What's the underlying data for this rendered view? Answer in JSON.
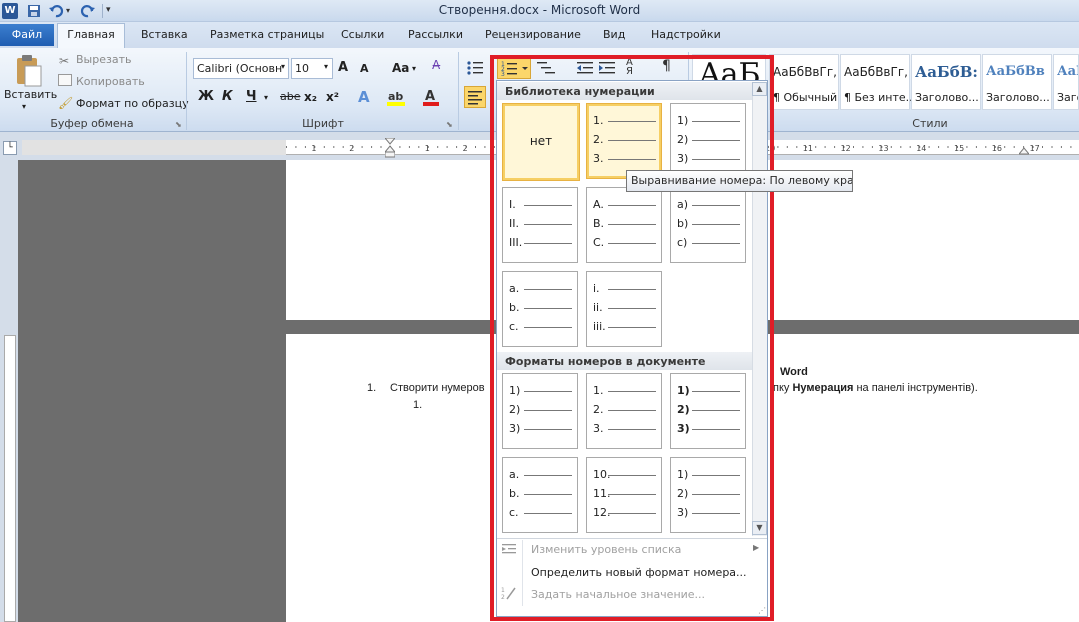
{
  "window": {
    "title": "Створення.docx  -  Microsoft Word"
  },
  "tabs": [
    {
      "label": "Файл"
    },
    {
      "label": "Главная"
    },
    {
      "label": "Вставка"
    },
    {
      "label": "Разметка страницы"
    },
    {
      "label": "Ссылки"
    },
    {
      "label": "Рассылки"
    },
    {
      "label": "Рецензирование"
    },
    {
      "label": "Вид"
    },
    {
      "label": "Надстройки"
    }
  ],
  "clipboard": {
    "paste": "Вставить",
    "cut": "Вырезать",
    "copy": "Копировать",
    "format_painter": "Формат по образцу",
    "group_label": "Буфер обмена"
  },
  "font": {
    "name": "Calibri (Основн",
    "size": "10",
    "grow": "A",
    "shrink": "A",
    "case": "Aa",
    "bold": "Ж",
    "italic": "К",
    "underline": "Ч",
    "strike": "abe",
    "subscript": "x₂",
    "superscript": "x²",
    "group_label": "Шрифт"
  },
  "styles": {
    "big_sample": "AaБ",
    "tiles": [
      {
        "sample": "АаБбВвГг,",
        "name": "¶ Обычный",
        "color": "#1e1e1e"
      },
      {
        "sample": "АаБбВвГг,",
        "name": "¶ Без инте...",
        "color": "#1e1e1e"
      },
      {
        "sample": "АаБбВ:",
        "name": "Заголово...",
        "color": "#2e5d94"
      },
      {
        "sample": "АаБбВв",
        "name": "Заголово...",
        "color": "#4f81bd"
      },
      {
        "sample": "АаБ",
        "name": "Заго",
        "color": "#4f81bd"
      }
    ],
    "group_label": "Стили"
  },
  "numbering_menu": {
    "library_header": "Библиотека нумерации",
    "library": [
      {
        "none_label": "нет",
        "rows": []
      },
      {
        "rows": [
          "1.",
          "2.",
          "3."
        ],
        "selected": true
      },
      {
        "rows": [
          "1)",
          "2)",
          "3)"
        ]
      },
      {
        "rows": [
          "I.",
          "II.",
          "III."
        ]
      },
      {
        "rows": [
          "A.",
          "B.",
          "C."
        ]
      },
      {
        "rows": [
          "a)",
          "b)",
          "c)"
        ]
      },
      {
        "rows": [
          "a.",
          "b.",
          "c."
        ]
      },
      {
        "rows": [
          "i.",
          "ii.",
          "iii."
        ]
      }
    ],
    "doc_header": "Форматы номеров в документе",
    "doc_formats": [
      {
        "rows": [
          "1)",
          "2)",
          "3)"
        ]
      },
      {
        "rows": [
          "1.",
          "2.",
          "3."
        ]
      },
      {
        "rows": [
          "1)",
          "2)",
          "3)"
        ],
        "bold": true
      },
      {
        "rows": [
          "a.",
          "b.",
          "c."
        ]
      },
      {
        "rows": [
          "10.",
          "11.",
          "12."
        ]
      },
      {
        "rows": [
          "1)",
          "2)",
          "3)"
        ]
      }
    ],
    "items": [
      {
        "label": "Изменить уровень списка",
        "enabled": false,
        "submenu": true
      },
      {
        "label": "Определить новый формат номера...",
        "enabled": true
      },
      {
        "label": "Задать начальное значение...",
        "enabled": false
      }
    ]
  },
  "tooltip": "Выравнивание номера: По левому краю",
  "document": {
    "heading_tail": "Word",
    "item1_number": "1.",
    "item1_start": "Створити нумеров",
    "item1_end_pre": "пку ",
    "item1_end_bold": "Нумерация",
    "item1_end_post": "  на панелі інструментів).",
    "sub_number": "1."
  },
  "ruler": {
    "labels": [
      "1",
      "2",
      "1",
      "2",
      "3",
      "4",
      "5",
      "6",
      "7",
      "8",
      "9",
      "10",
      "11",
      "12",
      "13",
      "14",
      "15",
      "16",
      "17"
    ]
  }
}
